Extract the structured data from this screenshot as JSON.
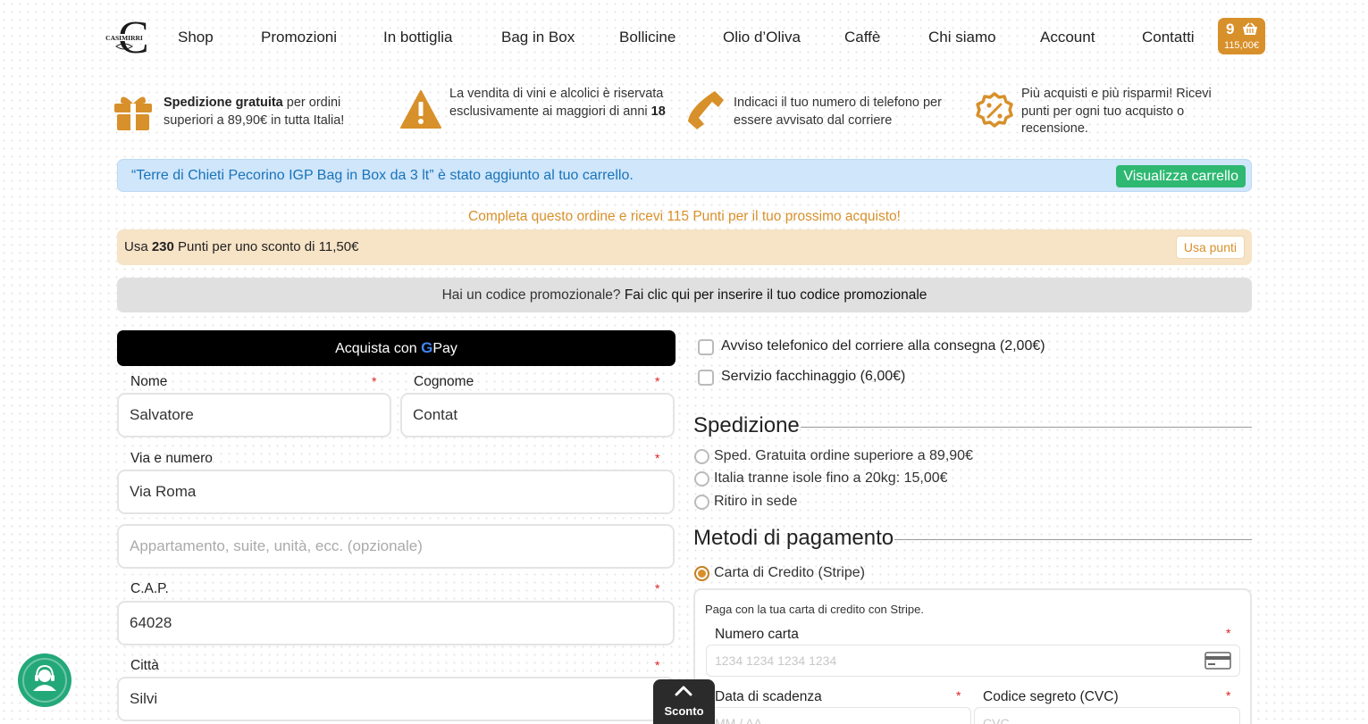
{
  "header": {
    "logo_text": "CASIMIRRI",
    "nav": [
      "Shop",
      "Promozioni",
      "In bottiglia",
      "Bag in Box",
      "Bollicine",
      "Olio d’Oliva",
      "Caffè",
      "Chi siamo",
      "Account",
      "Contatti"
    ],
    "cart": {
      "count": "9",
      "total": "115,00€"
    }
  },
  "features": [
    {
      "icon": "gift-icon",
      "bold": "Spedizione gratuita",
      "text": " per ordini superiori a 89,90€ in tutta Italia!"
    },
    {
      "icon": "warning-icon",
      "text": "La vendita di vini e alcolici è riservata esclusivamente ai maggiori di anni ",
      "bold": "18"
    },
    {
      "icon": "phone-icon",
      "text": "Indicaci il tuo numero di telefono per essere avvisato dal corriere"
    },
    {
      "icon": "discount-badge-icon",
      "text": "Più acquisti e più risparmi! Ricevi punti per ogni tuo acquisto o recensione."
    }
  ],
  "notices": {
    "cart_added": "“Terre di Chieti Pecorino IGP Bag in Box da 3 lt” è stato aggiunto al tuo carrello.",
    "view_cart": "Visualizza carrello",
    "points_earn": "Completa questo ordine e ricevi 115 Punti per il tuo prossimo acquisto!",
    "points_use_pre": "Usa ",
    "points_use_bold": "230",
    "points_use_post": " Punti per uno sconto di 11,50€",
    "use_points_btn": "Usa punti",
    "promo_question": "Hai un codice promozionale? ",
    "promo_link": "Fai clic qui per inserire il tuo codice promozionale"
  },
  "form": {
    "gpay_label": "Acquista con",
    "gpay_g": "G",
    "gpay_pay": "Pay",
    "nome_label": "Nome",
    "nome_value": "Salvatore",
    "cognome_label": "Cognome",
    "cognome_value": "Contat",
    "via_label": "Via e numero",
    "via_value": "Via Roma",
    "apt_placeholder": "Appartamento, suite, unità, ecc. (opzionale)",
    "cap_label": "C.A.P.",
    "cap_value": "64028",
    "citta_label": "Città",
    "citta_value": "Silvi",
    "required_mark": "*"
  },
  "options": {
    "extras": [
      "Avviso telefonico del corriere alla consegna (2,00€)",
      "Servizio facchinaggio (6,00€)"
    ],
    "shipping_title": "Spedizione",
    "shipping": [
      "Sped. Gratuita ordine superiore a 89,90€",
      "Italia tranne isole fino a 20kg: 15,00€",
      "Ritiro in sede"
    ],
    "payment_title": "Metodi di pagamento",
    "payment_selected": "Carta di Credito (Stripe)",
    "stripe_desc": "Paga con la tua carta di credito con Stripe.",
    "card_number_label": "Numero carta",
    "card_number_placeholder": "1234 1234 1234 1234",
    "expiry_label": "Data di scadenza",
    "expiry_placeholder": "MM / AA",
    "cvc_label": "Codice segreto (CVC)",
    "cvc_placeholder": "CVC"
  },
  "floating": {
    "sconto": "Sconto"
  },
  "colors": {
    "accent": "#d8902a",
    "success": "#2eb872",
    "support": "#23a87a"
  }
}
